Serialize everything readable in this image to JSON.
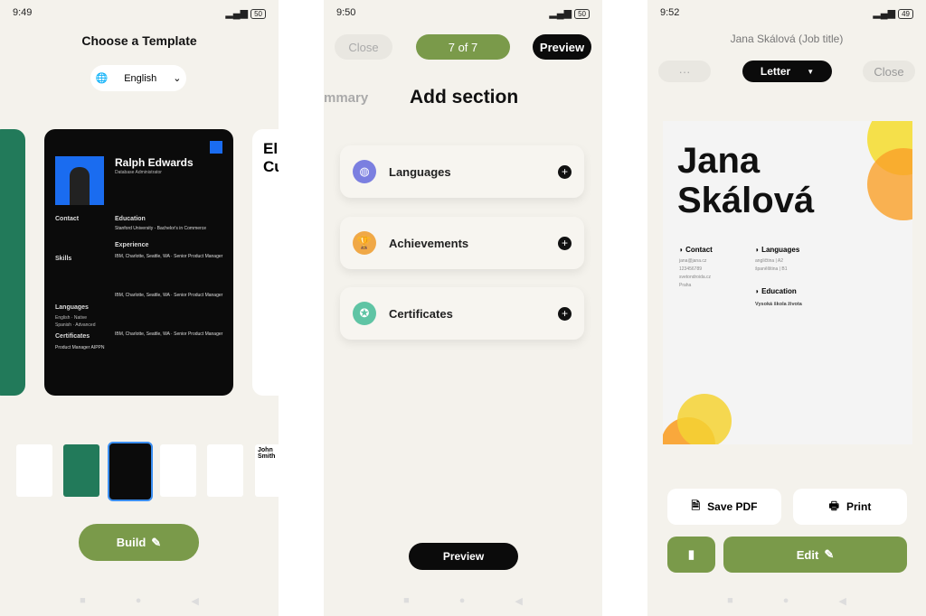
{
  "screen1": {
    "time": "9:49",
    "battery": "50",
    "title": "Choose a Template",
    "language": "English",
    "resume": {
      "name": "Ralph Edwards",
      "role": "Database Administrator",
      "sections": [
        "Contact",
        "Skills",
        "Languages",
        "Certificates",
        "Education",
        "Experience"
      ],
      "education": "Stanford University - Bachelor's in Commerce",
      "job": "IBM, Charlotte, Seattle, WA · Senior Product Manager",
      "langs": [
        "English · Native",
        "Spanish · Advanced"
      ],
      "cert": "Product Manager AIPPN"
    },
    "next_resume": {
      "name": "Eli Cu"
    },
    "thumb_last": "John Smith",
    "build": "Build"
  },
  "screen2": {
    "time": "9:50",
    "battery": "50",
    "close": "Close",
    "step": "7 of 7",
    "preview_top": "Preview",
    "prev_section": "mmary",
    "title": "Add section",
    "sections": [
      {
        "label": "Languages",
        "icon": "globe-icon",
        "color": "#7b7fe0"
      },
      {
        "label": "Achievements",
        "icon": "trophy-icon",
        "color": "#f0a847"
      },
      {
        "label": "Certificates",
        "icon": "certificate-icon",
        "color": "#5fc4a4"
      }
    ],
    "preview": "Preview"
  },
  "screen3": {
    "time": "9:52",
    "battery": "49",
    "header": "Jana Skálová  (Job title)",
    "more": "···",
    "format": "Letter",
    "close": "Close",
    "resume": {
      "first": "Jana",
      "last": "Skálová",
      "contact_h": "Contact",
      "contact": [
        "jana@jana.cz",
        "123456789",
        "svetondroida.cz",
        "Praha"
      ],
      "languages_h": "Languages",
      "languages": [
        "angličtina | A2",
        "španělština | B1"
      ],
      "education_h": "Education",
      "education": "Vysoká škola života"
    },
    "save_pdf": "Save PDF",
    "print": "Print",
    "edit": "Edit"
  },
  "colors": {
    "green": "#7a9a4a",
    "bg": "#f4f2ec",
    "dark": "#0b0b0b",
    "blue": "#1a6cf0"
  }
}
